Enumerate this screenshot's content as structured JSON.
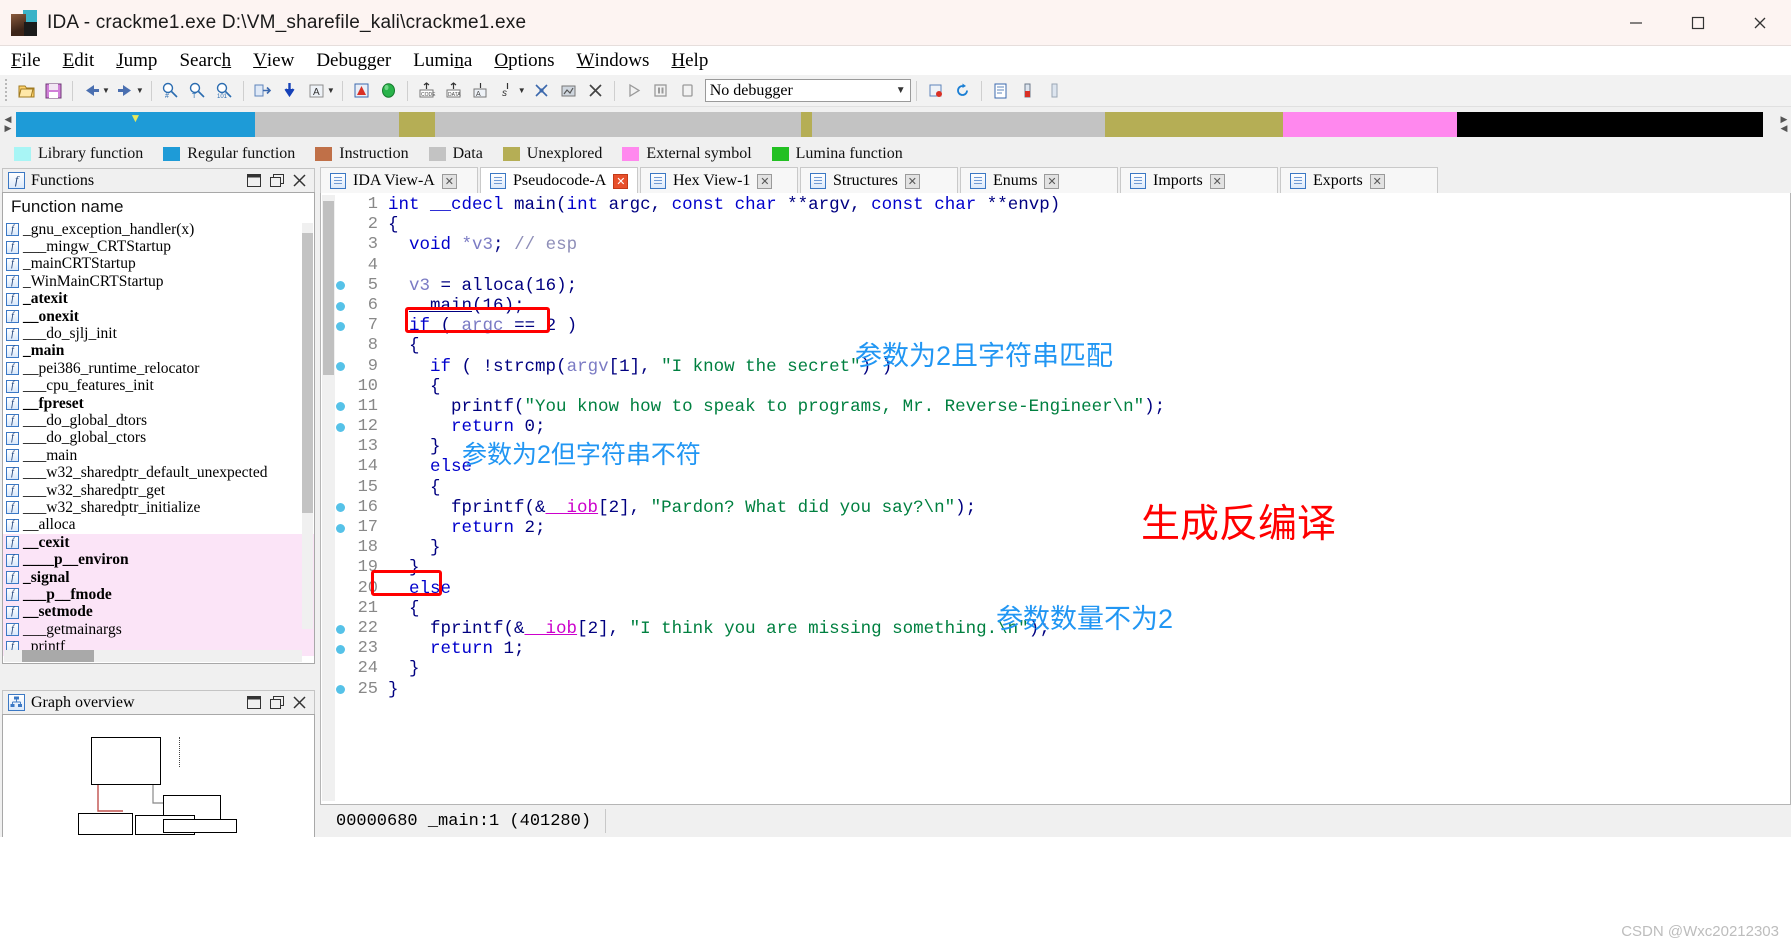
{
  "window": {
    "title": "IDA - crackme1.exe D:\\VM_sharefile_kali\\crackme1.exe",
    "app_icon": "ida-logo-icon",
    "minimize_label": "—",
    "maximize_label": "☐",
    "close_label": "✕"
  },
  "menubar": {
    "items": [
      {
        "label": "File",
        "accel": "F"
      },
      {
        "label": "Edit",
        "accel": "E"
      },
      {
        "label": "Jump",
        "accel": "J"
      },
      {
        "label": "Search",
        "accel": "h"
      },
      {
        "label": "View",
        "accel": "V"
      },
      {
        "label": "Debugger",
        "accel": "g"
      },
      {
        "label": "Lumina",
        "accel": "n"
      },
      {
        "label": "Options",
        "accel": "O"
      },
      {
        "label": "Windows",
        "accel": "W"
      },
      {
        "label": "Help",
        "accel": "H"
      }
    ]
  },
  "toolbar": {
    "debugger_selector_value": "No debugger",
    "buttons": [
      "open-file-icon",
      "save-icon",
      "navigate-back-icon",
      "navigate-forward-icon",
      "search-hex-icon",
      "search-text-icon",
      "search-number-icon",
      "jump-to-icon",
      "jump-down-icon",
      "rename-icon",
      "warning-icon",
      "run-to-icon",
      "make-code-icon",
      "make-data-icon",
      "make-array-icon",
      "make-struct-icon",
      "undefine-icon",
      "edit-function-icon",
      "delete-icon",
      "run-icon",
      "pause-icon",
      "stop-icon",
      "breakpoints-icon",
      "refresh-icon",
      "notepad-icon",
      "thermo-icon",
      "thermo2-icon"
    ]
  },
  "navigation_band": {
    "segments": [
      {
        "color": "#1e9bd7",
        "width_pct": 17.2,
        "name": "regular-function"
      },
      {
        "color": "#c3c3c3",
        "width_pct": 10.3,
        "name": "data"
      },
      {
        "color": "#b5ae55",
        "width_pct": 2.6,
        "name": "unexplored"
      },
      {
        "color": "#c3c3c3",
        "width_pct": 26.3,
        "name": "data"
      },
      {
        "color": "#b5ae55",
        "width_pct": 0.8,
        "name": "unexplored"
      },
      {
        "color": "#c3c3c3",
        "width_pct": 21.0,
        "name": "data"
      },
      {
        "color": "#b5ae55",
        "width_pct": 12.8,
        "name": "unexplored"
      },
      {
        "color": "#ff88ee",
        "width_pct": 12.5,
        "name": "external-symbol"
      },
      {
        "color": "#000000",
        "width_pct": 22.0,
        "name": "undefined"
      }
    ],
    "cursor_pct": 6.5
  },
  "legend": {
    "items": [
      {
        "label": "Library function",
        "color": "#a8f5f5"
      },
      {
        "label": "Regular function",
        "color": "#1e9bd7"
      },
      {
        "label": "Instruction",
        "color": "#c07048"
      },
      {
        "label": "Data",
        "color": "#c3c3c3"
      },
      {
        "label": "Unexplored",
        "color": "#b5ae55"
      },
      {
        "label": "External symbol",
        "color": "#ff88ee"
      },
      {
        "label": "Lumina function",
        "color": "#22c022"
      }
    ]
  },
  "functions_panel": {
    "title": "Functions",
    "column_header": "Function name",
    "items": [
      {
        "name": "_gnu_exception_handler(x)",
        "bold": false,
        "selected": false
      },
      {
        "name": "___mingw_CRTStartup",
        "bold": false,
        "selected": false
      },
      {
        "name": "_mainCRTStartup",
        "bold": false,
        "selected": false
      },
      {
        "name": "_WinMainCRTStartup",
        "bold": false,
        "selected": false
      },
      {
        "name": "_atexit",
        "bold": true,
        "selected": false
      },
      {
        "name": "__onexit",
        "bold": true,
        "selected": false
      },
      {
        "name": "___do_sjlj_init",
        "bold": false,
        "selected": false
      },
      {
        "name": "_main",
        "bold": true,
        "selected": false
      },
      {
        "name": "__pei386_runtime_relocator",
        "bold": false,
        "selected": false
      },
      {
        "name": "___cpu_features_init",
        "bold": false,
        "selected": false
      },
      {
        "name": "__fpreset",
        "bold": true,
        "selected": false
      },
      {
        "name": "___do_global_dtors",
        "bold": false,
        "selected": false
      },
      {
        "name": "___do_global_ctors",
        "bold": false,
        "selected": false
      },
      {
        "name": "___main",
        "bold": false,
        "selected": false
      },
      {
        "name": "___w32_sharedptr_default_unexpected",
        "bold": false,
        "selected": false
      },
      {
        "name": "___w32_sharedptr_get",
        "bold": false,
        "selected": false
      },
      {
        "name": "___w32_sharedptr_initialize",
        "bold": false,
        "selected": false
      },
      {
        "name": "__alloca",
        "bold": false,
        "selected": false
      },
      {
        "name": "__cexit",
        "bold": true,
        "selected": true
      },
      {
        "name": "____p__environ",
        "bold": true,
        "selected": true
      },
      {
        "name": "_signal",
        "bold": true,
        "selected": true
      },
      {
        "name": "___p__fmode",
        "bold": true,
        "selected": true
      },
      {
        "name": "__setmode",
        "bold": true,
        "selected": true
      },
      {
        "name": "___getmainargs",
        "bold": false,
        "selected": true
      },
      {
        "name": "_printf",
        "bold": false,
        "selected": true
      }
    ]
  },
  "graph_overview": {
    "title": "Graph overview"
  },
  "tabs": [
    {
      "label": "IDA View-A",
      "active": false,
      "closable": true
    },
    {
      "label": "Pseudocode-A",
      "active": true,
      "closable": true
    },
    {
      "label": "Hex View-1",
      "active": false,
      "closable": true
    },
    {
      "label": "Structures",
      "active": false,
      "closable": true
    },
    {
      "label": "Enums",
      "active": false,
      "closable": true
    },
    {
      "label": "Imports",
      "active": false,
      "closable": true
    },
    {
      "label": "Exports",
      "active": false,
      "closable": true
    }
  ],
  "code": {
    "lines": [
      {
        "n": 1,
        "dot": false,
        "tokens": [
          {
            "t": "int ",
            "c": "k"
          },
          {
            "t": "__cdecl ",
            "c": "k"
          },
          {
            "t": "main",
            "c": "id"
          },
          {
            "t": "(",
            "c": "id"
          },
          {
            "t": "int ",
            "c": "k"
          },
          {
            "t": "argc",
            "c": "id"
          },
          {
            "t": ", ",
            "c": "id"
          },
          {
            "t": "const ",
            "c": "k"
          },
          {
            "t": "char ",
            "c": "k"
          },
          {
            "t": "**argv",
            "c": "id"
          },
          {
            "t": ", ",
            "c": "id"
          },
          {
            "t": "const ",
            "c": "k"
          },
          {
            "t": "char ",
            "c": "k"
          },
          {
            "t": "**envp",
            "c": "id"
          },
          {
            "t": ")",
            "c": "id"
          }
        ]
      },
      {
        "n": 2,
        "dot": false,
        "tokens": [
          {
            "t": "{",
            "c": "id"
          }
        ]
      },
      {
        "n": 3,
        "dot": false,
        "tokens": [
          {
            "t": "  ",
            "c": "id"
          },
          {
            "t": "void ",
            "c": "k"
          },
          {
            "t": "*v3",
            "c": "var"
          },
          {
            "t": "; ",
            "c": "id"
          },
          {
            "t": "// esp",
            "c": "cmt"
          }
        ]
      },
      {
        "n": 4,
        "dot": false,
        "tokens": [
          {
            "t": "",
            "c": "id"
          }
        ]
      },
      {
        "n": 5,
        "dot": true,
        "tokens": [
          {
            "t": "  ",
            "c": "id"
          },
          {
            "t": "v3",
            "c": "var"
          },
          {
            "t": " = ",
            "c": "id"
          },
          {
            "t": "alloca",
            "c": "id"
          },
          {
            "t": "(",
            "c": "id"
          },
          {
            "t": "16",
            "c": "num"
          },
          {
            "t": ");",
            "c": "id"
          }
        ]
      },
      {
        "n": 6,
        "dot": true,
        "tokens": [
          {
            "t": "  ",
            "c": "id"
          },
          {
            "t": "__main",
            "c": "fnc"
          },
          {
            "t": "(",
            "c": "id"
          },
          {
            "t": "16",
            "c": "num"
          },
          {
            "t": ");",
            "c": "id"
          }
        ]
      },
      {
        "n": 7,
        "dot": true,
        "tokens": [
          {
            "t": "  ",
            "c": "id"
          },
          {
            "t": "if",
            "c": "k"
          },
          {
            "t": " ( ",
            "c": "id"
          },
          {
            "t": "argc",
            "c": "var"
          },
          {
            "t": " == ",
            "c": "id"
          },
          {
            "t": "2",
            "c": "num"
          },
          {
            "t": " )",
            "c": "id"
          }
        ]
      },
      {
        "n": 8,
        "dot": false,
        "tokens": [
          {
            "t": "  {",
            "c": "id"
          }
        ]
      },
      {
        "n": 9,
        "dot": true,
        "tokens": [
          {
            "t": "    ",
            "c": "id"
          },
          {
            "t": "if",
            "c": "k"
          },
          {
            "t": " ( !",
            "c": "id"
          },
          {
            "t": "strcmp",
            "c": "id"
          },
          {
            "t": "(",
            "c": "id"
          },
          {
            "t": "argv",
            "c": "var"
          },
          {
            "t": "[",
            "c": "id"
          },
          {
            "t": "1",
            "c": "num"
          },
          {
            "t": "], ",
            "c": "id"
          },
          {
            "t": "\"I know the secret\"",
            "c": "str"
          },
          {
            "t": ") )",
            "c": "id"
          }
        ]
      },
      {
        "n": 10,
        "dot": false,
        "tokens": [
          {
            "t": "    {",
            "c": "id"
          }
        ]
      },
      {
        "n": 11,
        "dot": true,
        "tokens": [
          {
            "t": "      ",
            "c": "id"
          },
          {
            "t": "printf",
            "c": "id"
          },
          {
            "t": "(",
            "c": "id"
          },
          {
            "t": "\"You know how to speak to programs, Mr. Reverse-Engineer\\n\"",
            "c": "str"
          },
          {
            "t": ");",
            "c": "id"
          }
        ]
      },
      {
        "n": 12,
        "dot": true,
        "tokens": [
          {
            "t": "      ",
            "c": "id"
          },
          {
            "t": "return ",
            "c": "k"
          },
          {
            "t": "0",
            "c": "num"
          },
          {
            "t": ";",
            "c": "id"
          }
        ]
      },
      {
        "n": 13,
        "dot": false,
        "tokens": [
          {
            "t": "    }",
            "c": "id"
          }
        ]
      },
      {
        "n": 14,
        "dot": false,
        "tokens": [
          {
            "t": "    ",
            "c": "id"
          },
          {
            "t": "else",
            "c": "k"
          }
        ]
      },
      {
        "n": 15,
        "dot": false,
        "tokens": [
          {
            "t": "    {",
            "c": "id"
          }
        ]
      },
      {
        "n": 16,
        "dot": true,
        "tokens": [
          {
            "t": "      ",
            "c": "id"
          },
          {
            "t": "fprintf",
            "c": "id"
          },
          {
            "t": "(&",
            "c": "id"
          },
          {
            "t": "__iob",
            "c": "glb"
          },
          {
            "t": "[",
            "c": "id"
          },
          {
            "t": "2",
            "c": "num"
          },
          {
            "t": "], ",
            "c": "id"
          },
          {
            "t": "\"Pardon? What did you say?\\n\"",
            "c": "str"
          },
          {
            "t": ");",
            "c": "id"
          }
        ]
      },
      {
        "n": 17,
        "dot": true,
        "tokens": [
          {
            "t": "      ",
            "c": "id"
          },
          {
            "t": "return ",
            "c": "k"
          },
          {
            "t": "2",
            "c": "num"
          },
          {
            "t": ";",
            "c": "id"
          }
        ]
      },
      {
        "n": 18,
        "dot": false,
        "tokens": [
          {
            "t": "    }",
            "c": "id"
          }
        ]
      },
      {
        "n": 19,
        "dot": false,
        "tokens": [
          {
            "t": "  }",
            "c": "id"
          }
        ]
      },
      {
        "n": 20,
        "dot": false,
        "tokens": [
          {
            "t": "  ",
            "c": "id"
          },
          {
            "t": "else",
            "c": "k"
          }
        ]
      },
      {
        "n": 21,
        "dot": false,
        "tokens": [
          {
            "t": "  {",
            "c": "id"
          }
        ]
      },
      {
        "n": 22,
        "dot": true,
        "tokens": [
          {
            "t": "    ",
            "c": "id"
          },
          {
            "t": "fprintf",
            "c": "id"
          },
          {
            "t": "(&",
            "c": "id"
          },
          {
            "t": "__iob",
            "c": "glb"
          },
          {
            "t": "[",
            "c": "id"
          },
          {
            "t": "2",
            "c": "num"
          },
          {
            "t": "], ",
            "c": "id"
          },
          {
            "t": "\"I think you are missing something.\\n\"",
            "c": "str"
          },
          {
            "t": ");",
            "c": "id"
          }
        ]
      },
      {
        "n": 23,
        "dot": true,
        "tokens": [
          {
            "t": "    ",
            "c": "id"
          },
          {
            "t": "return ",
            "c": "k"
          },
          {
            "t": "1",
            "c": "num"
          },
          {
            "t": ";",
            "c": "id"
          }
        ]
      },
      {
        "n": 24,
        "dot": false,
        "tokens": [
          {
            "t": "  }",
            "c": "id"
          }
        ]
      },
      {
        "n": 25,
        "dot": true,
        "tokens": [
          {
            "t": "}",
            "c": "id"
          }
        ]
      }
    ]
  },
  "annotations": {
    "argc_match": "参数为2且字符串匹配",
    "argc_mismatch": "参数为2但字符串不符",
    "decompile": "生成反编译",
    "argc_not_two": "参数数量不为2"
  },
  "statusbar": {
    "address": "00000680 _main:1 (401280)",
    "watermark": "CSDN @Wxc20212303"
  },
  "colors": {
    "accent_blue": "#1e9bd7",
    "annotation_blue": "#2196f3",
    "annotation_red": "#ff0000",
    "selection_pink": "#fbe4f7",
    "string_green": "#008040",
    "keyword_blue": "#0000cc"
  }
}
